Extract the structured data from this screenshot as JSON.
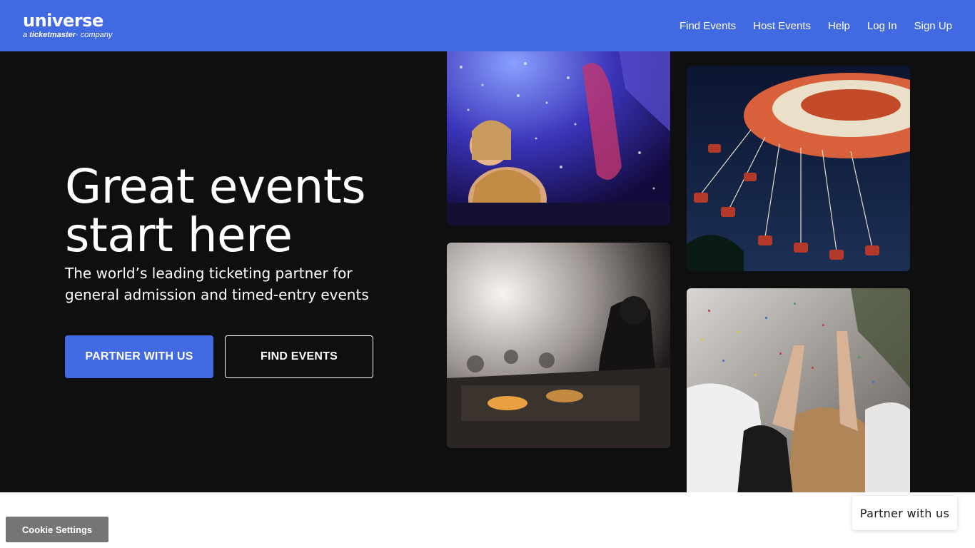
{
  "colors": {
    "brand": "#4169e1",
    "hero_bg": "#0f0f10",
    "cookie_bg": "#757575"
  },
  "header": {
    "logo_main": "universe",
    "logo_prefix": "a",
    "logo_brand": "ticketmaster",
    "logo_suffix": "company",
    "nav": [
      "Find Events",
      "Host Events",
      "Help",
      "Log In",
      "Sign Up"
    ]
  },
  "hero": {
    "title": "Great events start here",
    "subtitle": "The world’s leading ticketing partner for general admission and timed-entry events",
    "primary_button": "PARTNER WITH US",
    "secondary_button": "FIND EVENTS",
    "images": [
      "festival-bubbles-photo",
      "swing-ride-photo",
      "dj-stage-photo",
      "confetti-crowd-photo"
    ]
  },
  "cookie_settings": "Cookie Settings",
  "partner_float": "Partner with us"
}
